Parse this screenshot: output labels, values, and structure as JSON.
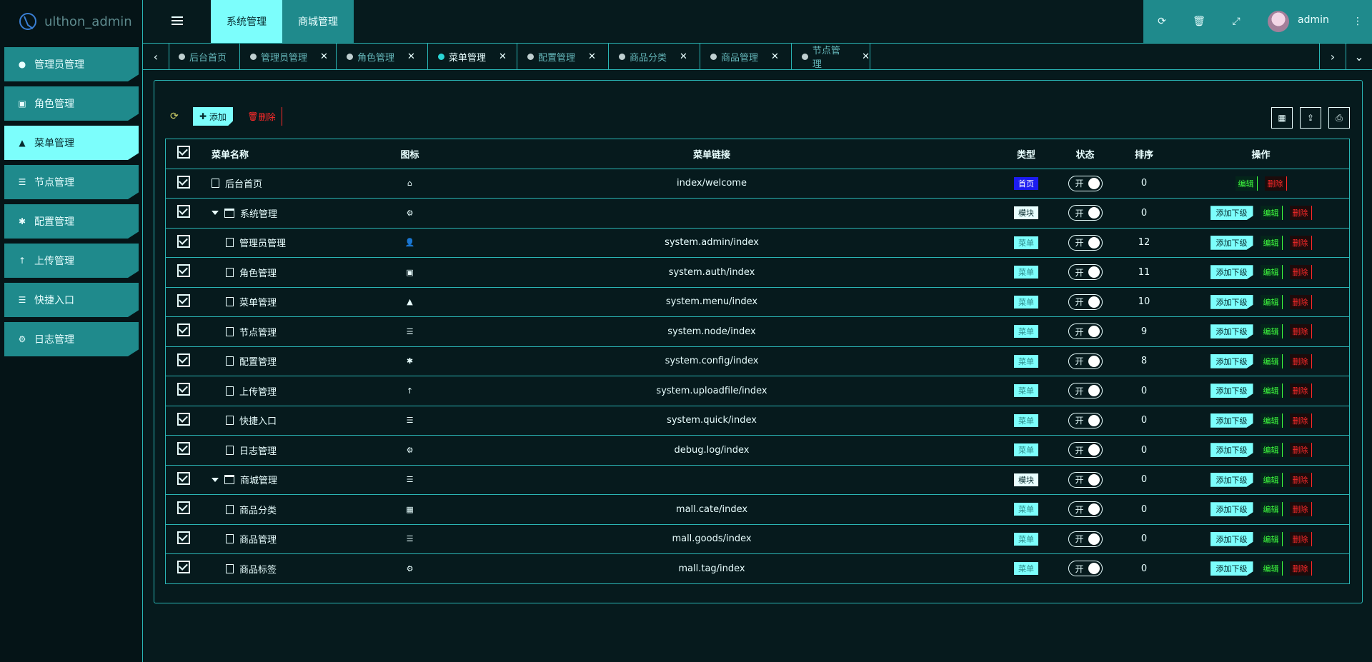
{
  "app": {
    "title": "ulthon_admin"
  },
  "sidebar": {
    "items": [
      {
        "label": "管理员管理",
        "icon": "user-icon"
      },
      {
        "label": "角色管理",
        "icon": "id-card-icon"
      },
      {
        "label": "菜单管理",
        "icon": "tree-icon"
      },
      {
        "label": "节点管理",
        "icon": "list-icon"
      },
      {
        "label": "配置管理",
        "icon": "asterisk-icon"
      },
      {
        "label": "上传管理",
        "icon": "arrow-up-icon"
      },
      {
        "label": "快捷入口",
        "icon": "list-icon"
      },
      {
        "label": "日志管理",
        "icon": "gear-outline-icon"
      }
    ]
  },
  "header": {
    "tabs": [
      "系统管理",
      "商城管理"
    ],
    "user": "admin"
  },
  "tabs": [
    {
      "label": "后台首页",
      "closable": false
    },
    {
      "label": "管理员管理",
      "closable": true
    },
    {
      "label": "角色管理",
      "closable": true
    },
    {
      "label": "菜单管理",
      "closable": true
    },
    {
      "label": "配置管理",
      "closable": true
    },
    {
      "label": "商品分类",
      "closable": true
    },
    {
      "label": "商品管理",
      "closable": true
    },
    {
      "label": "节点管理",
      "closable": true
    }
  ],
  "toolbar": {
    "add_label": "添加",
    "delete_label": "删除"
  },
  "table": {
    "headers": [
      "菜单名称",
      "图标",
      "菜单链接",
      "类型",
      "状态",
      "排序",
      "操作"
    ],
    "switch_label": "开",
    "op_add_sub": "添加下级",
    "op_edit": "编辑",
    "op_delete": "删除",
    "rows": [
      {
        "name": "后台首页",
        "level": 0,
        "kind": "file",
        "icon": "⌂",
        "link": "index/welcome",
        "type": "首页",
        "type_kind": "home",
        "sort": "0",
        "has_add": false
      },
      {
        "name": "系统管理",
        "level": 0,
        "kind": "folder",
        "icon": "⚙",
        "link": "",
        "type": "模块",
        "type_kind": "module",
        "sort": "0",
        "has_add": true
      },
      {
        "name": "管理员管理",
        "level": 1,
        "kind": "file",
        "icon": "👤",
        "link": "system.admin/index",
        "type": "菜单",
        "type_kind": "menu",
        "sort": "12",
        "has_add": true
      },
      {
        "name": "角色管理",
        "level": 1,
        "kind": "file",
        "icon": "▣",
        "link": "system.auth/index",
        "type": "菜单",
        "type_kind": "menu",
        "sort": "11",
        "has_add": true
      },
      {
        "name": "菜单管理",
        "level": 1,
        "kind": "file",
        "icon": "▲",
        "link": "system.menu/index",
        "type": "菜单",
        "type_kind": "menu",
        "sort": "10",
        "has_add": true
      },
      {
        "name": "节点管理",
        "level": 1,
        "kind": "file",
        "icon": "☰",
        "link": "system.node/index",
        "type": "菜单",
        "type_kind": "menu",
        "sort": "9",
        "has_add": true
      },
      {
        "name": "配置管理",
        "level": 1,
        "kind": "file",
        "icon": "✱",
        "link": "system.config/index",
        "type": "菜单",
        "type_kind": "menu",
        "sort": "8",
        "has_add": true
      },
      {
        "name": "上传管理",
        "level": 1,
        "kind": "file",
        "icon": "↑",
        "link": "system.uploadfile/index",
        "type": "菜单",
        "type_kind": "menu",
        "sort": "0",
        "has_add": true
      },
      {
        "name": "快捷入口",
        "level": 1,
        "kind": "file",
        "icon": "☰",
        "link": "system.quick/index",
        "type": "菜单",
        "type_kind": "menu",
        "sort": "0",
        "has_add": true
      },
      {
        "name": "日志管理",
        "level": 1,
        "kind": "file",
        "icon": "⚙",
        "link": "debug.log/index",
        "type": "菜单",
        "type_kind": "menu",
        "sort": "0",
        "has_add": true
      },
      {
        "name": "商城管理",
        "level": 0,
        "kind": "folder",
        "icon": "☰",
        "link": "",
        "type": "模块",
        "type_kind": "module",
        "sort": "0",
        "has_add": true
      },
      {
        "name": "商品分类",
        "level": 1,
        "kind": "file",
        "icon": "▦",
        "link": "mall.cate/index",
        "type": "菜单",
        "type_kind": "menu",
        "sort": "0",
        "has_add": true
      },
      {
        "name": "商品管理",
        "level": 1,
        "kind": "file",
        "icon": "☰",
        "link": "mall.goods/index",
        "type": "菜单",
        "type_kind": "menu",
        "sort": "0",
        "has_add": true
      },
      {
        "name": "商品标签",
        "level": 1,
        "kind": "file",
        "icon": "⚙",
        "link": "mall.tag/index",
        "type": "菜单",
        "type_kind": "menu",
        "sort": "0",
        "has_add": true
      }
    ]
  }
}
